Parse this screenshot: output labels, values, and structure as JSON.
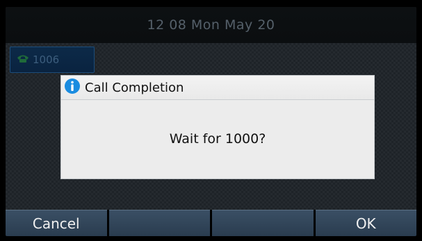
{
  "status_bar": {
    "datetime": "12 08 Mon May 20"
  },
  "line_key": {
    "label": "1006",
    "icon": "phone-handset-icon"
  },
  "dialog": {
    "icon": "info-icon",
    "title": "Call Completion",
    "message": "Wait for 1000?"
  },
  "softkeys": [
    {
      "label": "Cancel"
    },
    {
      "label": ""
    },
    {
      "label": ""
    },
    {
      "label": "OK"
    }
  ],
  "colors": {
    "softkey_bg": "#34485c",
    "line_key_bg": "#0c2a48",
    "dialog_bg": "#ececec",
    "info_icon": "#1a8ce0"
  }
}
